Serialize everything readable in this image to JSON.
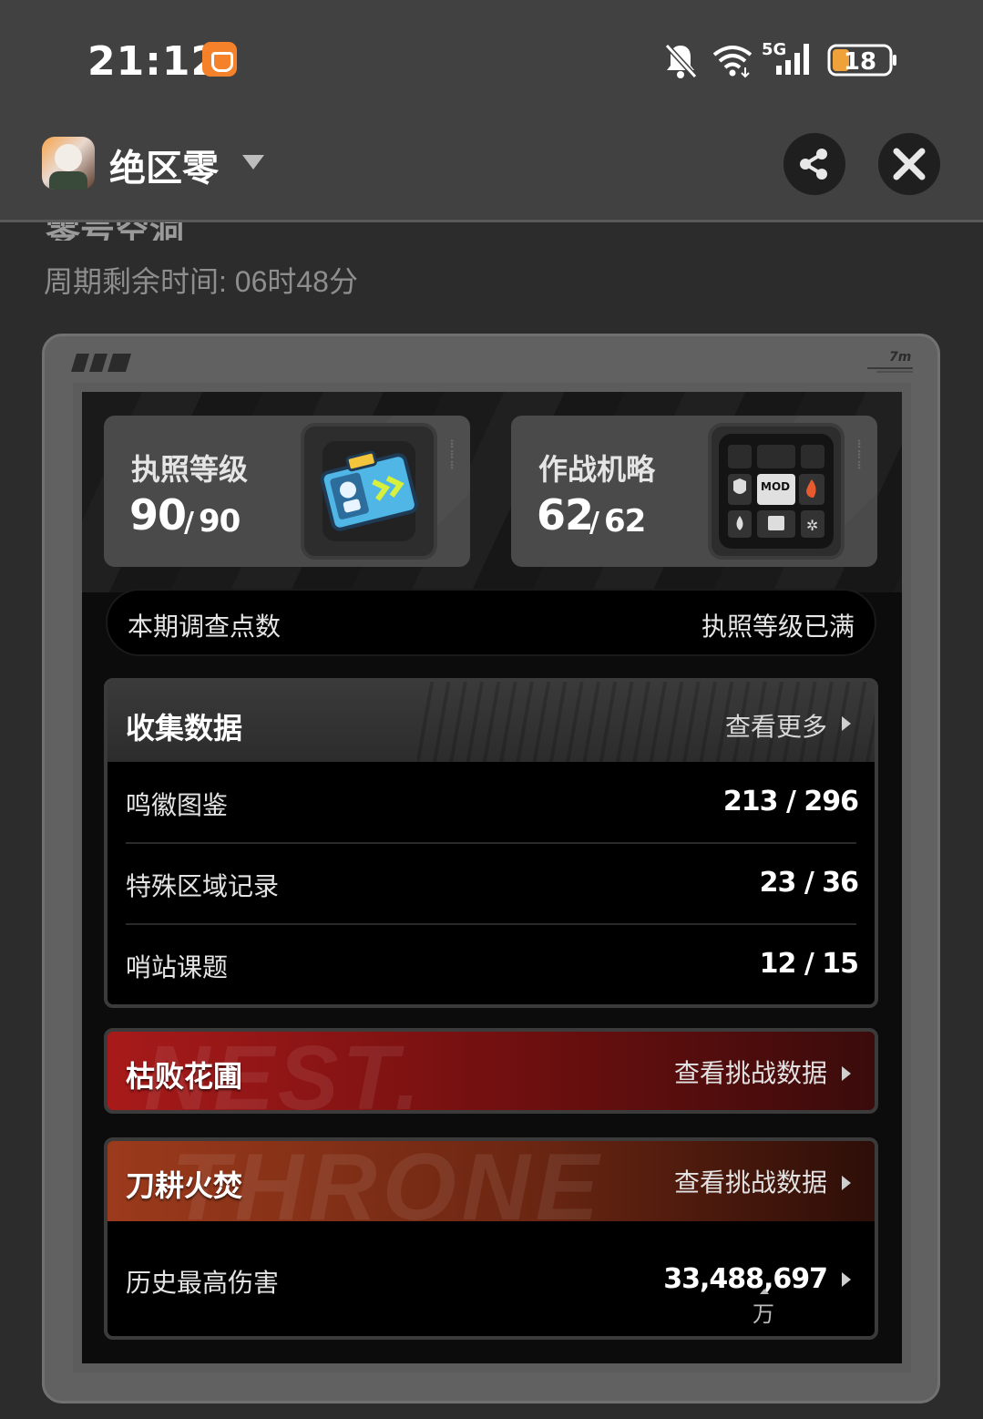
{
  "status_bar": {
    "time": "21:12",
    "battery": "18",
    "network": "5G"
  },
  "app_header": {
    "title": "绝区零"
  },
  "section": {
    "title": "零号空洞",
    "cycle_time": "周期剩余时间: 06时48分"
  },
  "stats": [
    {
      "label": "执照等级",
      "value": "90",
      "max": "90",
      "icon": "license-card-icon"
    },
    {
      "label": "作战机略",
      "value": "62",
      "max": "62",
      "icon": "mod-grid-icon"
    }
  ],
  "survey_points": {
    "label": "本期调查点数",
    "status": "执照等级已满"
  },
  "collection": {
    "title": "收集数据",
    "more_label": "查看更多",
    "rows": [
      {
        "label": "鸣徽图鉴",
        "value": "213 / 296"
      },
      {
        "label": "特殊区域记录",
        "value": "23 / 36"
      },
      {
        "label": "哨站课题",
        "value": "12 / 15"
      }
    ]
  },
  "challenges": [
    {
      "title": "枯败花圃",
      "link_label": "查看挑战数据",
      "watermark": "NEST.",
      "accent": "#a81a1a"
    },
    {
      "title": "刀耕火焚",
      "link_label": "查看挑战数据",
      "watermark": "THRONE",
      "accent": "#9c3a1c"
    }
  ],
  "blade_stats": {
    "label": "历史最高伤害",
    "value": "33,488,697",
    "unit": "万"
  },
  "colors": {
    "background": "#2c2c2c",
    "header": "#414141",
    "card": "#616161",
    "red_challenge": "#a81a1a",
    "orange_challenge": "#9c3a1c"
  }
}
